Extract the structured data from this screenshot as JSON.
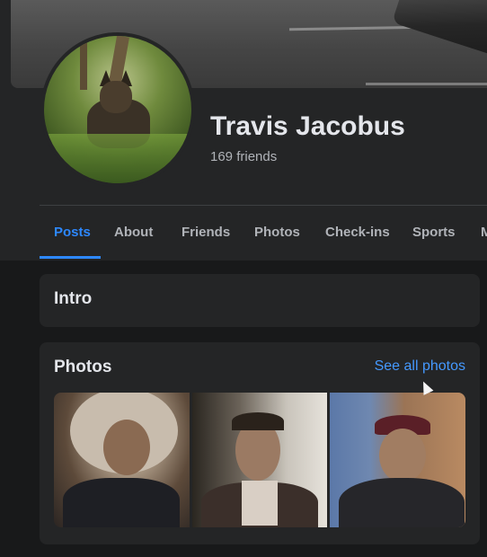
{
  "profile": {
    "name": "Travis Jacobus",
    "friends_text": "169 friends"
  },
  "tabs": [
    {
      "label": "Posts",
      "active": true
    },
    {
      "label": "About",
      "active": false
    },
    {
      "label": "Friends",
      "active": false
    },
    {
      "label": "Photos",
      "active": false
    },
    {
      "label": "Check-ins",
      "active": false
    },
    {
      "label": "Sports",
      "active": false
    },
    {
      "label": "M",
      "active": false
    }
  ],
  "intro": {
    "title": "Intro"
  },
  "photos": {
    "title": "Photos",
    "see_all": "See all photos"
  },
  "colors": {
    "background": "#18191a",
    "card": "#242526",
    "accent": "#2d88ff",
    "link": "#4599ff",
    "text_primary": "#e4e6eb",
    "text_secondary": "#b0b3b8"
  }
}
